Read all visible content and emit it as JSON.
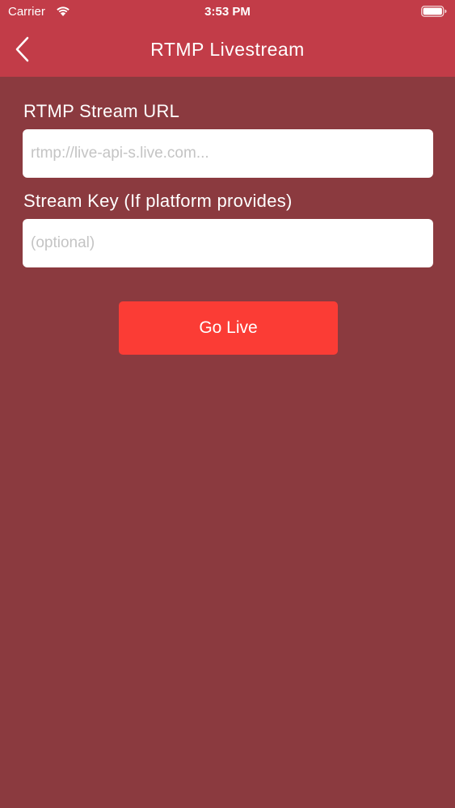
{
  "status_bar": {
    "carrier": "Carrier",
    "time": "3:53 PM",
    "wifi_icon": "wifi-icon",
    "battery_icon": "battery-icon"
  },
  "nav": {
    "back_icon": "chevron-left-icon",
    "title": "RTMP Livestream"
  },
  "form": {
    "url_label": "RTMP Stream URL",
    "url_value": "",
    "url_placeholder": "rtmp://live-api-s.live.com...",
    "key_label": "Stream Key (If platform provides)",
    "key_value": "",
    "key_placeholder": "(optional)",
    "submit_label": "Go Live"
  },
  "colors": {
    "header": "#c23c48",
    "background": "#8b3a3f",
    "button": "#fb3c35",
    "text": "#ffffff"
  }
}
